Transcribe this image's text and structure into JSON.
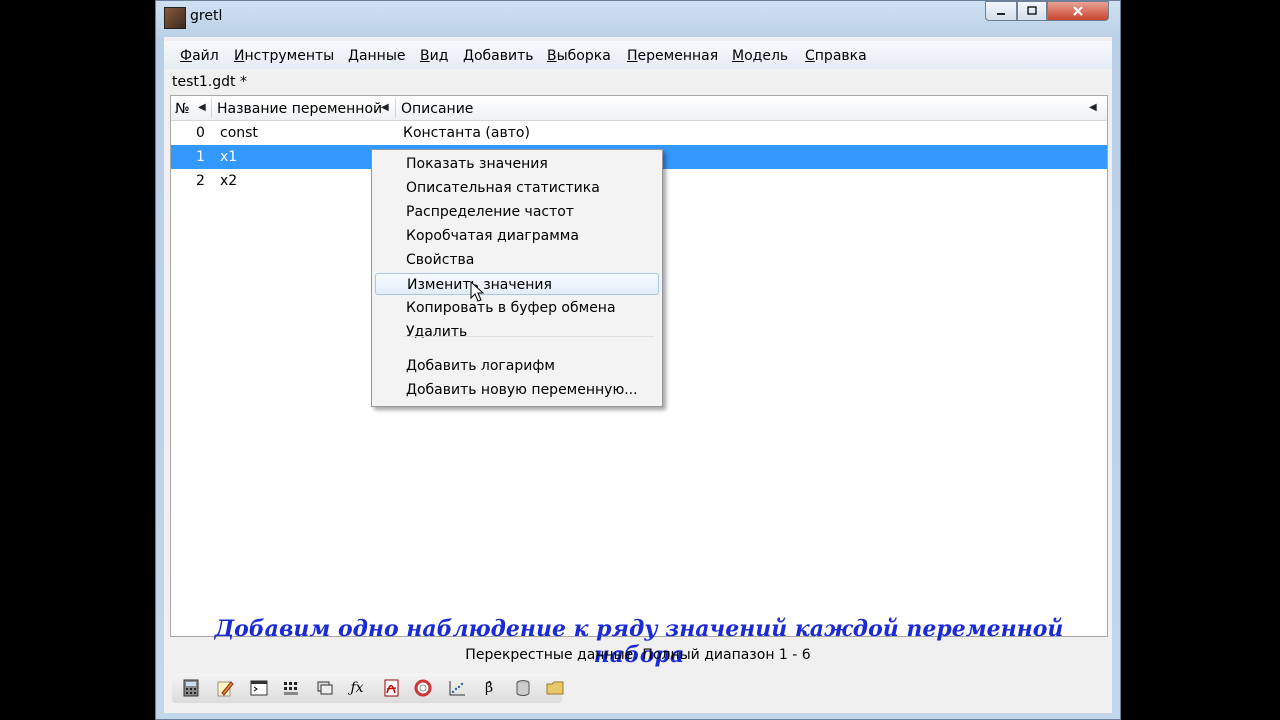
{
  "window": {
    "title": "gretl"
  },
  "menu": [
    "Файл",
    "Инструменты",
    "Данные",
    "Вид",
    "Добавить",
    "Выборка",
    "Переменная",
    "Модель",
    "Справка"
  ],
  "file_label": "test1.gdt *",
  "list": {
    "headers": {
      "num": "№",
      "name": "Название переменной",
      "desc": "Описание"
    },
    "rows": [
      {
        "id": "0",
        "name": "const",
        "desc": "Константа (авто)"
      },
      {
        "id": "1",
        "name": "x1",
        "desc": ""
      },
      {
        "id": "2",
        "name": "x2",
        "desc": ""
      }
    ],
    "selected_row": 1
  },
  "context_menu": {
    "items": [
      "Показать значения",
      "Описательная статистика",
      "Распределение частот",
      "Коробчатая диаграмма",
      "Свойства",
      "Изменить значения",
      "Копировать в буфер обмена",
      "Удалить"
    ],
    "extra_items": [
      "Добавить логарифм",
      "Добавить новую переменную..."
    ],
    "hovered_index": 5
  },
  "annotation": "Добавим одно наблюдение к ряду значений каждой переменной набора",
  "status": "Перекрестные данные: Полный диапазон 1 - 6",
  "toolbar_icons": [
    "calculator-icon",
    "edit-icon",
    "console-icon",
    "grid-icon",
    "sessions-icon",
    "function-icon",
    "pdf-icon",
    "help-icon",
    "scatter-icon",
    "beta-icon",
    "database-icon",
    "folder-icon"
  ],
  "colors": {
    "selection": "#3399ff",
    "annotation": "#1a2bd6"
  }
}
